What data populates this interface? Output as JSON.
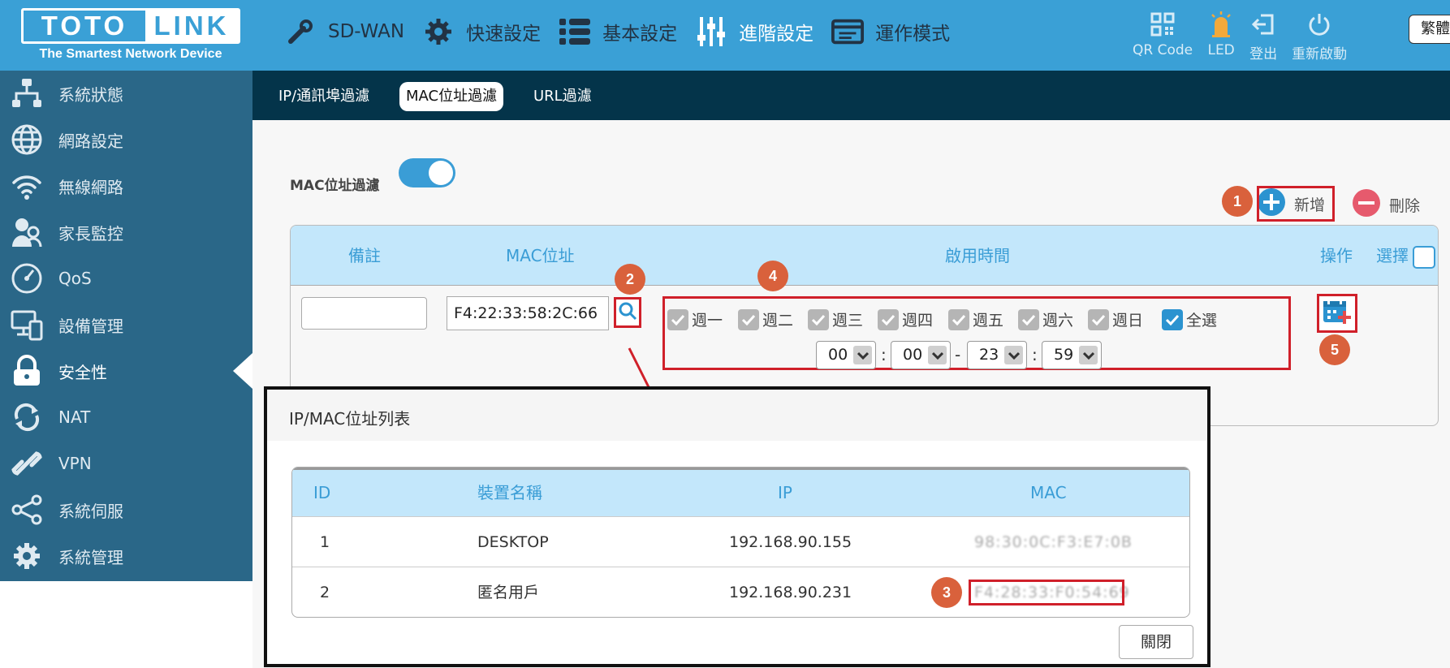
{
  "brand": {
    "name_left": "TOTO",
    "name_right": "LINK",
    "tagline": "The Smartest Network Device"
  },
  "topnav": [
    {
      "label": "SD-WAN",
      "icon": "wrench-icon"
    },
    {
      "label": "快速設定",
      "icon": "gear-icon"
    },
    {
      "label": "基本設定",
      "icon": "list-icon"
    },
    {
      "label": "進階設定",
      "icon": "sliders-icon",
      "active": true
    },
    {
      "label": "運作模式",
      "icon": "router-icon"
    }
  ],
  "topright": [
    {
      "label": "QR Code",
      "icon": "qr-code-icon"
    },
    {
      "label": "LED",
      "icon": "led-icon"
    },
    {
      "label": "登出",
      "icon": "logout-icon"
    },
    {
      "label": "重新啟動",
      "icon": "power-icon"
    }
  ],
  "language": "繁體",
  "sidebar": [
    {
      "label": "系統狀態",
      "icon": "network-status-icon"
    },
    {
      "label": "網路設定",
      "icon": "globe-icon"
    },
    {
      "label": "無線網路",
      "icon": "wifi-icon"
    },
    {
      "label": "家長監控",
      "icon": "parental-icon"
    },
    {
      "label": "QoS",
      "icon": "gauge-icon"
    },
    {
      "label": "設備管理",
      "icon": "devices-icon"
    },
    {
      "label": "安全性",
      "icon": "lock-icon",
      "active": true
    },
    {
      "label": "NAT",
      "icon": "refresh-icon"
    },
    {
      "label": "VPN",
      "icon": "link-icon"
    },
    {
      "label": "系統伺服",
      "icon": "share-icon"
    },
    {
      "label": "系統管理",
      "icon": "settings-icon"
    }
  ],
  "tabs": [
    {
      "label": "IP/通訊埠過濾"
    },
    {
      "label": "MAC位址過濾",
      "active": true
    },
    {
      "label": "URL過濾"
    }
  ],
  "filter": {
    "label": "MAC位址過濾",
    "enabled": true,
    "add_label": "新增",
    "delete_label": "刪除"
  },
  "rule_table": {
    "headers": {
      "note": "備註",
      "mac": "MAC位址",
      "time": "啟用時間",
      "action": "操作",
      "select": "選擇"
    },
    "mac_value": "F4:22:33:58:2C:66",
    "note_value": "",
    "days": [
      {
        "label": "週一",
        "checked": true
      },
      {
        "label": "週二",
        "checked": true
      },
      {
        "label": "週三",
        "checked": true
      },
      {
        "label": "週四",
        "checked": true
      },
      {
        "label": "週五",
        "checked": true
      },
      {
        "label": "週六",
        "checked": true
      },
      {
        "label": "週日",
        "checked": true
      },
      {
        "label": "全選",
        "checked": true
      }
    ],
    "time": {
      "start_hour": "00",
      "start_min": "00",
      "end_hour": "23",
      "end_min": "59",
      "colon": ":",
      "dash": "-"
    }
  },
  "badges": {
    "b1": "1",
    "b2": "2",
    "b3": "3",
    "b4": "4",
    "b5": "5"
  },
  "popup": {
    "title": "IP/MAC位址列表",
    "headers": {
      "id": "ID",
      "name": "裝置名稱",
      "ip": "IP",
      "mac": "MAC"
    },
    "rows": [
      {
        "id": "1",
        "name": "DESKTOP",
        "ip": "192.168.90.155",
        "mac": "98:30:0C:F3:E7:0B"
      },
      {
        "id": "2",
        "name": "匿名用戶",
        "ip": "192.168.90.231",
        "mac": "F4:28:33:F0:54:69"
      }
    ],
    "close_label": "關閉"
  },
  "colors": {
    "topbar": "#3aa0d6",
    "sidebar": "#2a6788",
    "tabbar": "#04344a",
    "accent": "#3a9dd6",
    "highlight": "#d0202a",
    "badge": "#d9613c"
  }
}
